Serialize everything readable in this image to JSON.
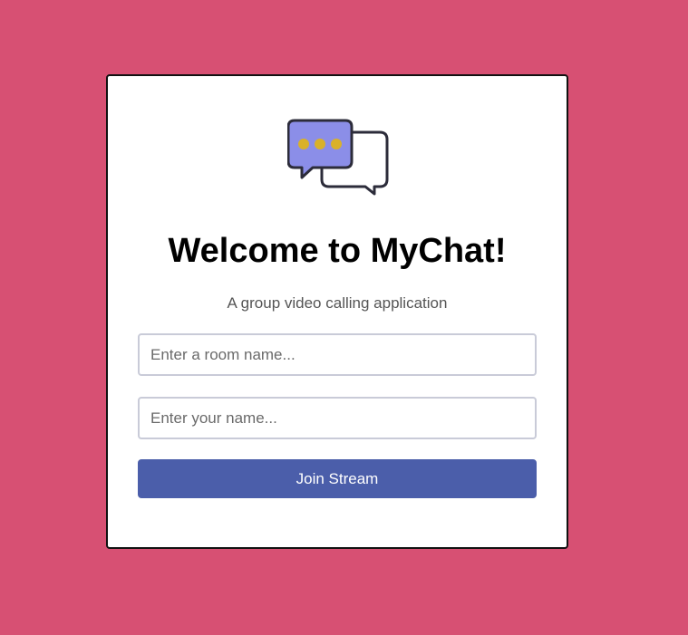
{
  "card": {
    "title": "Welcome to MyChat!",
    "subtitle": "A group video calling application"
  },
  "form": {
    "room_placeholder": "Enter a room name...",
    "room_value": "",
    "name_placeholder": "Enter your name...",
    "name_value": "",
    "join_label": "Join Stream"
  },
  "icons": {
    "logo": "chat-bubbles-icon"
  },
  "colors": {
    "background": "#d75073",
    "card": "#ffffff",
    "button": "#4b5eaa",
    "bubble_fill": "#8b8ee8",
    "bubble_dots": "#d9b12a",
    "bubble_stroke": "#2c2c3a"
  }
}
